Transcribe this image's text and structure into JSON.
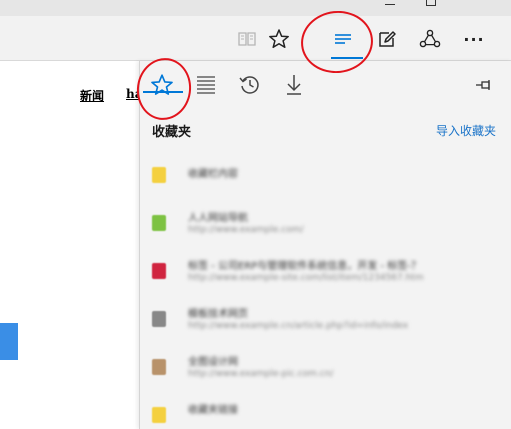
{
  "toolbar": {
    "reading_view_icon": "book-icon",
    "favorites_icon": "star-icon",
    "hub_icon": "hub-lines-icon",
    "notes_icon": "pen-note-icon",
    "share_icon": "share-icon",
    "more_icon": "ellipsis-icon",
    "more_label": "···"
  },
  "page": {
    "news_link": "新闻",
    "hao_link": "hao"
  },
  "hub": {
    "tabs": [
      {
        "icon": "star-icon",
        "active": true
      },
      {
        "icon": "reading-list-icon",
        "active": false
      },
      {
        "icon": "history-icon",
        "active": false
      },
      {
        "icon": "download-icon",
        "active": false
      }
    ],
    "pin_icon": "pin-icon",
    "title": "收藏夹",
    "import_label": "导入收藏夹",
    "favorites": [
      {
        "icon_color": "#f4d03f",
        "title": "收藏栏内容",
        "url": ""
      },
      {
        "icon_color": "#7dc242",
        "title": "人人网站导航",
        "url": "http://www.example.com/"
      },
      {
        "icon_color": "#d0243f",
        "title": "标签 - 公司ERP与管理软件系统信息，开发 - 标签-？",
        "url": "http://www.example-site.com/list/item/1234567.htm"
      },
      {
        "icon_color": "#888888",
        "title": "模板技术网页",
        "url": "http://www.example.cn/article.php?id=info/index"
      },
      {
        "icon_color": "#b8926a",
        "title": "全图设计网",
        "url": "http://www.example-pic.com.cn/"
      },
      {
        "icon_color": "#f4d03f",
        "title": "收藏夹链接",
        "url": ""
      }
    ]
  },
  "colors": {
    "accent": "#0078d7",
    "annotation": "#e2141c"
  }
}
